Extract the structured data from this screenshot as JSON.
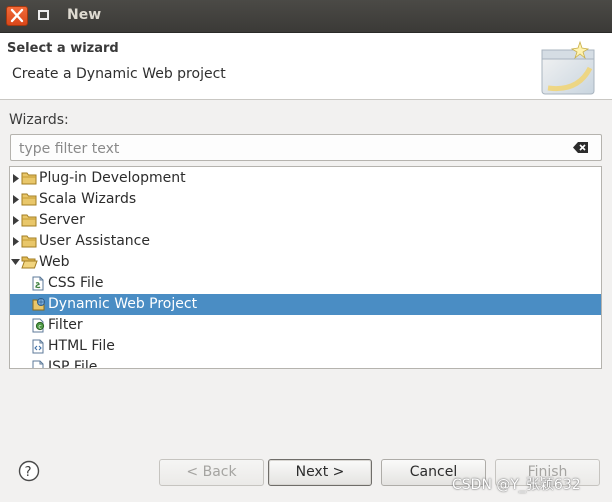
{
  "window": {
    "title": "New",
    "colors": {
      "titlebar": "#3b3a37",
      "close_button": "#e05a27",
      "selection": "#4a8dc4"
    }
  },
  "banner": {
    "title": "Select a wizard",
    "description": "Create a Dynamic Web project"
  },
  "wizards_label": "Wizards:",
  "filter": {
    "placeholder": "type filter text",
    "value": ""
  },
  "tree": {
    "items": [
      {
        "label": "Plug-in Development",
        "type": "folder",
        "expanded": false,
        "depth": 0,
        "icon": "folder-icon"
      },
      {
        "label": "Scala Wizards",
        "type": "folder",
        "expanded": false,
        "depth": 0,
        "icon": "folder-icon"
      },
      {
        "label": "Server",
        "type": "folder",
        "expanded": false,
        "depth": 0,
        "icon": "folder-icon"
      },
      {
        "label": "User Assistance",
        "type": "folder",
        "expanded": false,
        "depth": 0,
        "icon": "folder-icon"
      },
      {
        "label": "Web",
        "type": "folder",
        "expanded": true,
        "depth": 0,
        "icon": "folder-open-icon"
      },
      {
        "label": "CSS File",
        "type": "item",
        "depth": 1,
        "icon": "css-file-icon"
      },
      {
        "label": "Dynamic Web Project",
        "type": "item",
        "depth": 1,
        "selected": true,
        "icon": "web-project-icon"
      },
      {
        "label": "Filter",
        "type": "item",
        "depth": 1,
        "icon": "filter-icon"
      },
      {
        "label": "HTML File",
        "type": "item",
        "depth": 1,
        "icon": "html-file-icon"
      },
      {
        "label": "JSP File",
        "type": "item",
        "depth": 1,
        "icon": "jsp-file-icon"
      }
    ]
  },
  "buttons": {
    "back": "< Back",
    "next": "Next >",
    "cancel": "Cancel",
    "finish": "Finish"
  },
  "watermark": "CSDN @Y_张颖632"
}
